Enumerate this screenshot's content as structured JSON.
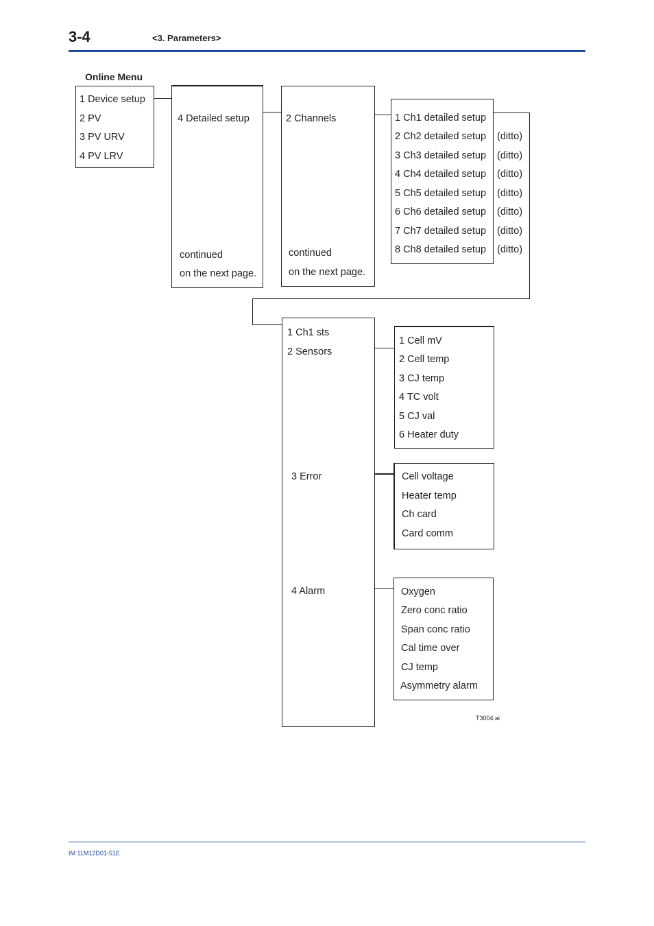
{
  "header": {
    "page_number": "3-4",
    "section_title": "<3. Parameters>",
    "accent_color": "#1f4e9c"
  },
  "diagram": {
    "title": "Online Menu",
    "online_menu": [
      "1 Device setup",
      "2 PV",
      "3 PV URV",
      "4 PV LRV"
    ],
    "device_setup": {
      "item": "4 Detailed setup",
      "continued": [
        "continued",
        "on the next page."
      ]
    },
    "detailed_setup": {
      "item": "2 Channels",
      "continued": [
        "continued",
        "on the next page."
      ]
    },
    "channels": {
      "items": [
        "1 Ch1 detailed setup",
        "2 Ch2 detailed setup",
        "3 Ch3 detailed setup",
        "4 Ch4 detailed setup",
        "5 Ch5 detailed setup",
        "6 Ch6 detailed setup",
        "7 Ch7 detailed setup",
        "8 Ch8 detailed setup"
      ],
      "ditto": "(ditto)"
    },
    "ch1_detailed": {
      "items": [
        "1 Ch1 sts",
        "2 Sensors",
        "3 Error",
        "4 Alarm"
      ]
    },
    "sensors": [
      "1 Cell mV",
      "2 Cell temp",
      "3 CJ temp",
      "4 TC volt",
      "5 CJ val",
      "6 Heater duty"
    ],
    "error": [
      "Cell voltage",
      "Heater temp",
      "Ch card",
      "Card comm"
    ],
    "alarm": [
      "Oxygen",
      "Zero conc ratio",
      "Span conc ratio",
      "Cal time over",
      "CJ temp",
      "Asymmetry alarm"
    ],
    "figure_label": "T3004.ai"
  },
  "footer": {
    "doc_id": "IM 11M12D01-51E"
  }
}
